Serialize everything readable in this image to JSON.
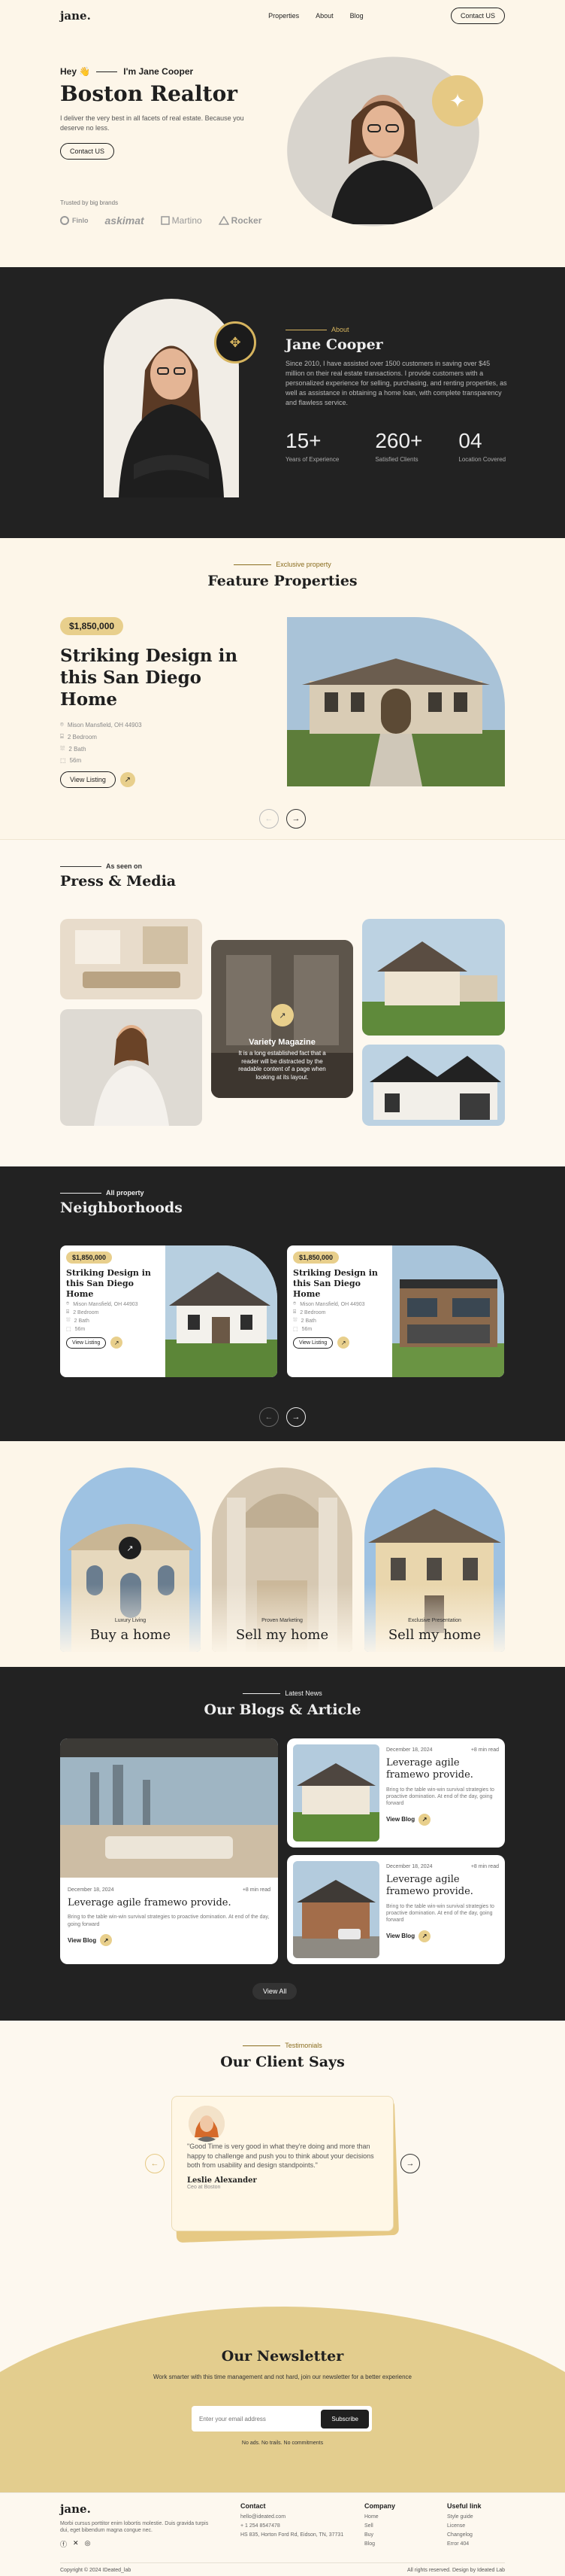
{
  "nav": {
    "logo": "jane.",
    "links": [
      "Properties",
      "About",
      "Blog"
    ],
    "contact": "Contact US"
  },
  "hero": {
    "hey": "Hey 👋",
    "name_tag": "I'm Jane Cooper",
    "title": "Boston Realtor",
    "desc": "I deliver the very best in all facets of real estate. Because you deserve no less.",
    "cta": "Contact US",
    "trusted": "Trusted by big brands",
    "brands": [
      "Finlo",
      "askimat",
      "Martino",
      "Rocker"
    ]
  },
  "about": {
    "kicker": "About",
    "name": "Jane Cooper",
    "desc": "Since 2010, I have assisted over 1500 customers in saving over $45 million on their real estate transactions. I provide customers with a personalized experience for selling, purchasing, and renting properties, as well as assistance in obtaining a home loan, with complete transparency and flawless service.",
    "stats": [
      {
        "num": "15+",
        "label": "Years of Experience"
      },
      {
        "num": "260+",
        "label": "Satisfied Clients"
      },
      {
        "num": "04",
        "label": "Location Covered"
      }
    ]
  },
  "featured": {
    "kicker": "Exclusive property",
    "title": "Feature Properties",
    "price": "$1,850,000",
    "prop_title": "Striking Design in this San Diego Home",
    "address": "Mison Mansfield, OH 44903",
    "bed": "2 Bedroom",
    "bath": "2 Bath",
    "area": "56m",
    "view": "View Listing"
  },
  "press": {
    "kicker": "As seen on",
    "title": "Press & Media",
    "variety_title": "Variety Magazine",
    "variety_desc": "It is a long established fact that a reader will be distracted by the readable content of a page when looking at its layout."
  },
  "neigh": {
    "kicker": "All property",
    "title": "Neighborhoods",
    "cards": [
      {
        "price": "$1,850,000",
        "title": "Striking Design in this San Diego Home",
        "address": "Mison Mansfield, OH 44903",
        "bed": "2 Bedroom",
        "bath": "2 Bath",
        "area": "56m",
        "view": "View Listing"
      },
      {
        "price": "$1,850,000",
        "title": "Striking Design in this San Diego Home",
        "address": "Mison Mansfield, OH 44903",
        "bed": "2 Bedroom",
        "bath": "2 Bath",
        "area": "56m",
        "view": "View Listing"
      }
    ]
  },
  "services": [
    {
      "label": "Luxury Living",
      "title": "Buy a home"
    },
    {
      "label": "Proven Marketing",
      "title": "Sell my home"
    },
    {
      "label": "Exclusive Presentation",
      "title": "Sell my home"
    }
  ],
  "blogs": {
    "kicker": "Latest News",
    "title": "Our Blogs & Article",
    "big": {
      "date": "December 18, 2024",
      "read": "+8 min read",
      "title": "Leverage agile framewo provide.",
      "desc": "Bring to the table win-win survival strategies to proactive domination. At end of the day, going forward",
      "view": "View Blog"
    },
    "small": [
      {
        "date": "December 18, 2024",
        "read": "+8 min read",
        "title": "Leverage agile framewo provide.",
        "desc": "Bring to the table win-win survival strategies to proactive domination. At end of the day, going forward",
        "view": "View Blog"
      },
      {
        "date": "December 18, 2024",
        "read": "+8 min read",
        "title": "Leverage agile framewo provide.",
        "desc": "Bring to the table win-win survival strategies to proactive domination. At end of the day, going forward",
        "view": "View Blog"
      }
    ],
    "view_all": "View All"
  },
  "testimonials": {
    "kicker": "Testimonials",
    "title": "Our Client Says",
    "quote": "\"Good Time is very good in what they're doing and more than happy to challenge and push you to think about your decisions both from usability and design standpoints.\"",
    "name": "Leslie Alexander",
    "role": "Ceo at Boston"
  },
  "newsletter": {
    "title": "Our Newsletter",
    "desc": "Work smarter with this time management and not hard, join our newsletter for a better experience",
    "placeholder": "Enter your email address",
    "button": "Subscribe",
    "note": "No ads. No trails. No commitments"
  },
  "footer": {
    "logo": "jane.",
    "desc": "Morbi cursus porttitor enim lobortis molestie. Duis gravida turpis dui, eget bibendum magna congue nec.",
    "contact_head": "Contact",
    "contact": [
      "hello@ideated.com",
      "+ 1 254 8547478",
      "HS 835, Horton Ford Rd, Eidson, TN, 37731"
    ],
    "company_head": "Company",
    "company": [
      "Home",
      "Sell",
      "Buy",
      "Blog"
    ],
    "links_head": "Useful link",
    "links": [
      "Style guide",
      "License",
      "Changelog",
      "Error 404"
    ],
    "copyright": "Copyright © 2024 IDeated_lab",
    "rights": "All rights reserved. Design by Ideated Lab"
  }
}
